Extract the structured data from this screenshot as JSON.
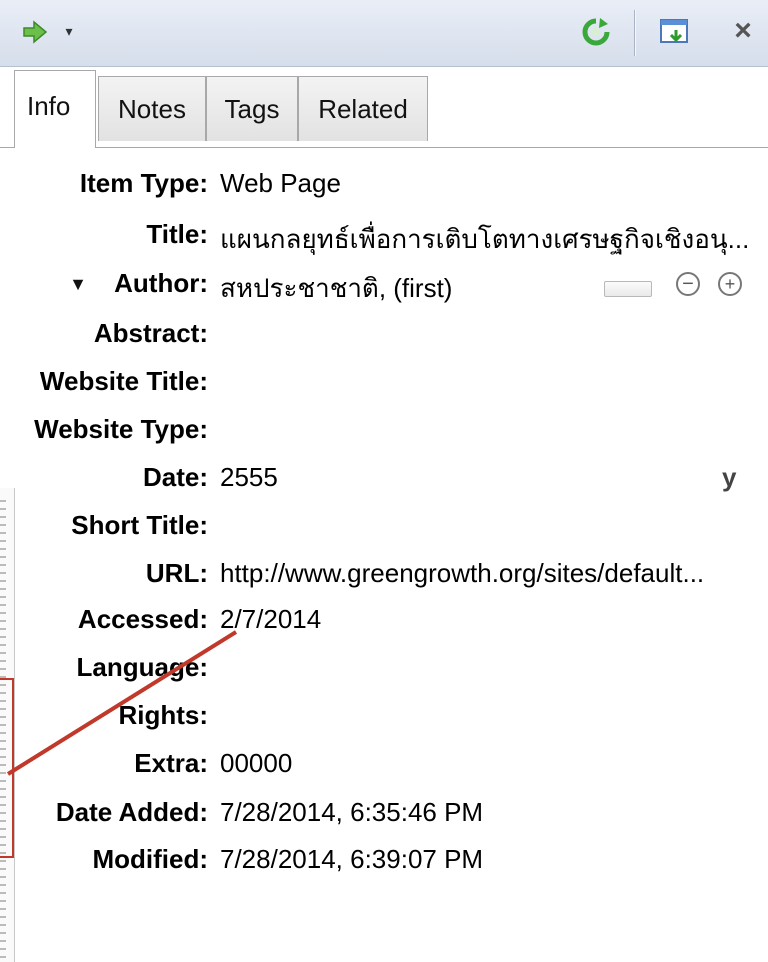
{
  "tabs": [
    {
      "label": "Info"
    },
    {
      "label": "Notes"
    },
    {
      "label": "Tags"
    },
    {
      "label": "Related"
    }
  ],
  "fields": {
    "item_type": {
      "label": "Item Type:",
      "value": "Web Page"
    },
    "title": {
      "label": "Title:",
      "value": "แผนกลยุทธ์เพื่อการเติบโตทางเศรษฐกิจเชิงอนุ..."
    },
    "author": {
      "label": "Author:",
      "value": "สหประชาชาติ, (first)"
    },
    "abstract": {
      "label": "Abstract:",
      "value": ""
    },
    "website_title": {
      "label": "Website Title:",
      "value": ""
    },
    "website_type": {
      "label": "Website Type:",
      "value": ""
    },
    "date": {
      "label": "Date:",
      "value": "2555",
      "format_indicator": "y"
    },
    "short_title": {
      "label": "Short Title:",
      "value": ""
    },
    "url": {
      "label": "URL:",
      "value": "http://www.greengrowth.org/sites/default..."
    },
    "accessed": {
      "label": "Accessed:",
      "value": "2/7/2014"
    },
    "language": {
      "label": "Language:",
      "value": ""
    },
    "rights": {
      "label": "Rights:",
      "value": ""
    },
    "extra": {
      "label": "Extra:",
      "value": "00000"
    },
    "date_added": {
      "label": "Date Added:",
      "value": "7/28/2014, 6:35:46 PM"
    },
    "modified": {
      "label": "Modified:",
      "value": "7/28/2014, 6:39:07 PM"
    }
  },
  "toolbar": {
    "icons": [
      "go-arrow-icon",
      "dropdown-icon",
      "refresh-icon",
      "new-window-icon",
      "close-icon"
    ],
    "close_glyph": "×",
    "dropdown_glyph": "▾"
  },
  "author_controls": {
    "toggle_glyph": "▼",
    "minus_glyph": "−",
    "plus_glyph": "+"
  },
  "colors": {
    "annotation_red": "#c0392b",
    "refresh_green": "#3aa83a",
    "arrow_green": "#4caf50"
  }
}
